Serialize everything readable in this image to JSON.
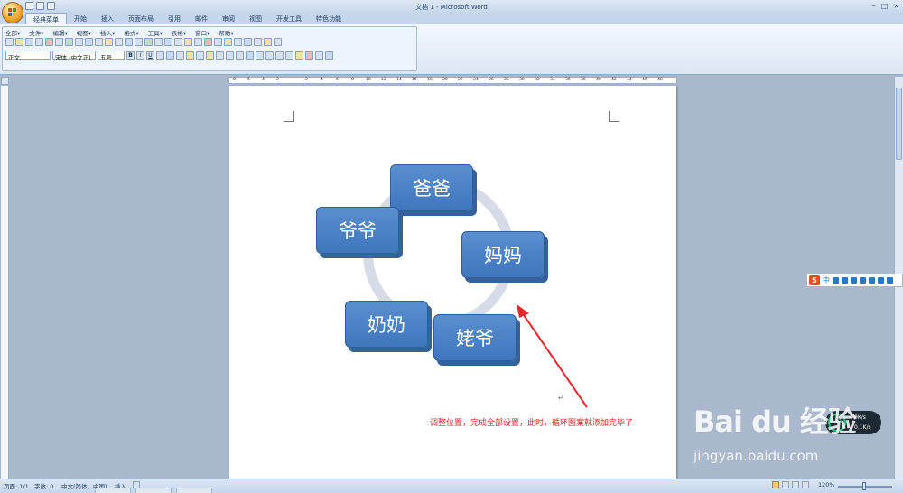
{
  "window": {
    "title": "文档 1 - Microsoft Word"
  },
  "tabs": [
    {
      "label": "经典菜单"
    },
    {
      "label": "开始"
    },
    {
      "label": "插入"
    },
    {
      "label": "页面布局"
    },
    {
      "label": "引用"
    },
    {
      "label": "邮件"
    },
    {
      "label": "审阅"
    },
    {
      "label": "视图"
    },
    {
      "label": "开发工具"
    },
    {
      "label": "特色功能"
    }
  ],
  "menu": [
    {
      "label": "全部▾"
    },
    {
      "label": "文件▾"
    },
    {
      "label": "编辑▾"
    },
    {
      "label": "视图▾"
    },
    {
      "label": "插入▾"
    },
    {
      "label": "格式▾"
    },
    {
      "label": "工具▾"
    },
    {
      "label": "表格▾"
    },
    {
      "label": "窗口▾"
    },
    {
      "label": "帮助▾"
    }
  ],
  "format": {
    "style": "正文",
    "font": "宋体 (中文正)",
    "size": "五号",
    "bold": "B",
    "italic": "I",
    "underline": "U"
  },
  "ruler": {
    "marks": [
      "8",
      "6",
      "4",
      "2",
      "2",
      "4",
      "6",
      "8",
      "10",
      "12",
      "14",
      "16",
      "18",
      "20",
      "22",
      "24",
      "26",
      "28",
      "30",
      "32",
      "34",
      "36",
      "38",
      "40",
      "42",
      "44",
      "46",
      "48"
    ]
  },
  "diagram": {
    "items": [
      {
        "label": "爸爸"
      },
      {
        "label": "妈妈"
      },
      {
        "label": "姥爷"
      },
      {
        "label": "奶奶"
      },
      {
        "label": "爷爷"
      }
    ],
    "fill_color": "#4a80c4",
    "ring_color": "#d7dbe8"
  },
  "annotation": {
    "text": "调整位置，完成全部设置，此时，循环图案就添加完毕了",
    "color": "#e8262c"
  },
  "paragraph_mark": "↵",
  "ime": {
    "logo": "S",
    "mode": "中"
  },
  "network": {
    "percent": "76%",
    "up": "0K/s",
    "down": "0.1K/s"
  },
  "status": {
    "page": "页面: 1/1",
    "words": "字数: 0",
    "lang": "中文(简体，中国)",
    "mode": "插入",
    "zoom": "120%"
  },
  "watermark": {
    "brand": "Bai du 经验",
    "url": "jingyan.baidu.com"
  }
}
